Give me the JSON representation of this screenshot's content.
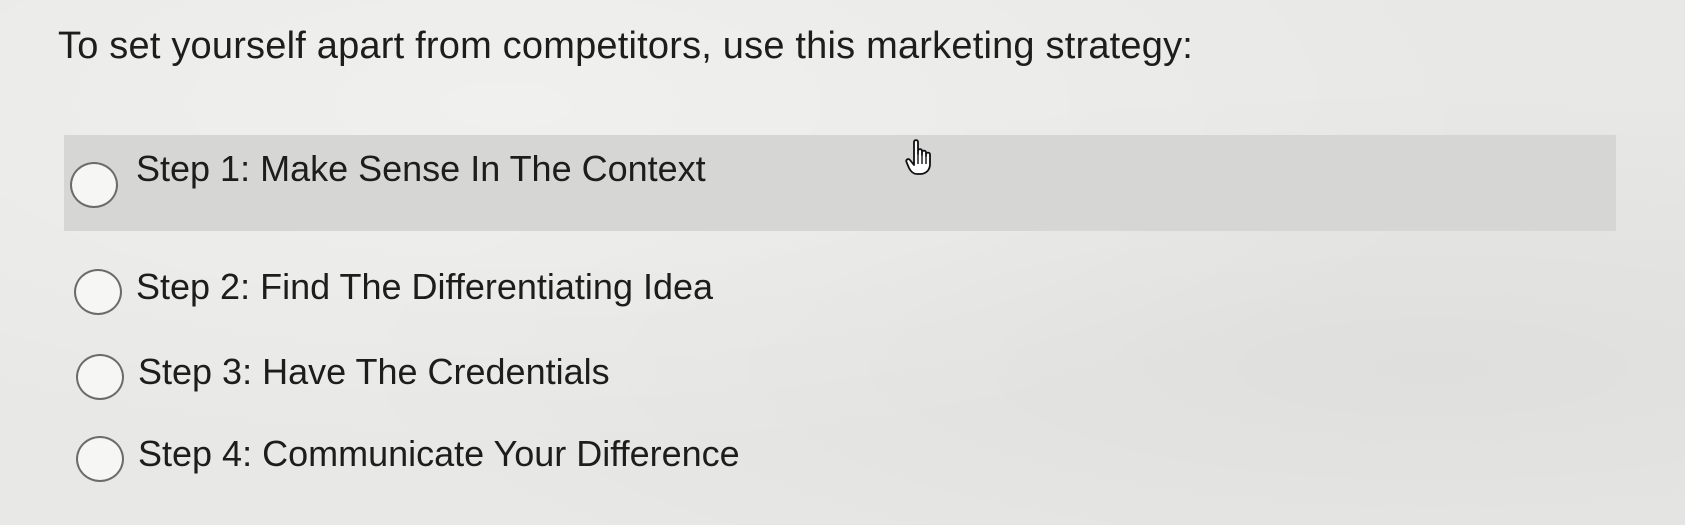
{
  "question": {
    "text": "To set yourself apart from competitors, use this marketing strategy:"
  },
  "options": [
    {
      "label": "Step 1: Make Sense In The Context",
      "highlighted": true
    },
    {
      "label": "Step 2: Find The Differentiating Idea",
      "highlighted": false
    },
    {
      "label": "Step 3: Have The Credentials",
      "highlighted": false
    },
    {
      "label": "Step 4: Communicate Your Difference",
      "highlighted": false
    }
  ],
  "cursor": {
    "icon": "hand-pointer-icon"
  },
  "colors": {
    "background": "#e8e8e6",
    "highlight": "#d6d6d4",
    "text": "#1d1d1d",
    "radio_border": "#6b6b6b"
  }
}
